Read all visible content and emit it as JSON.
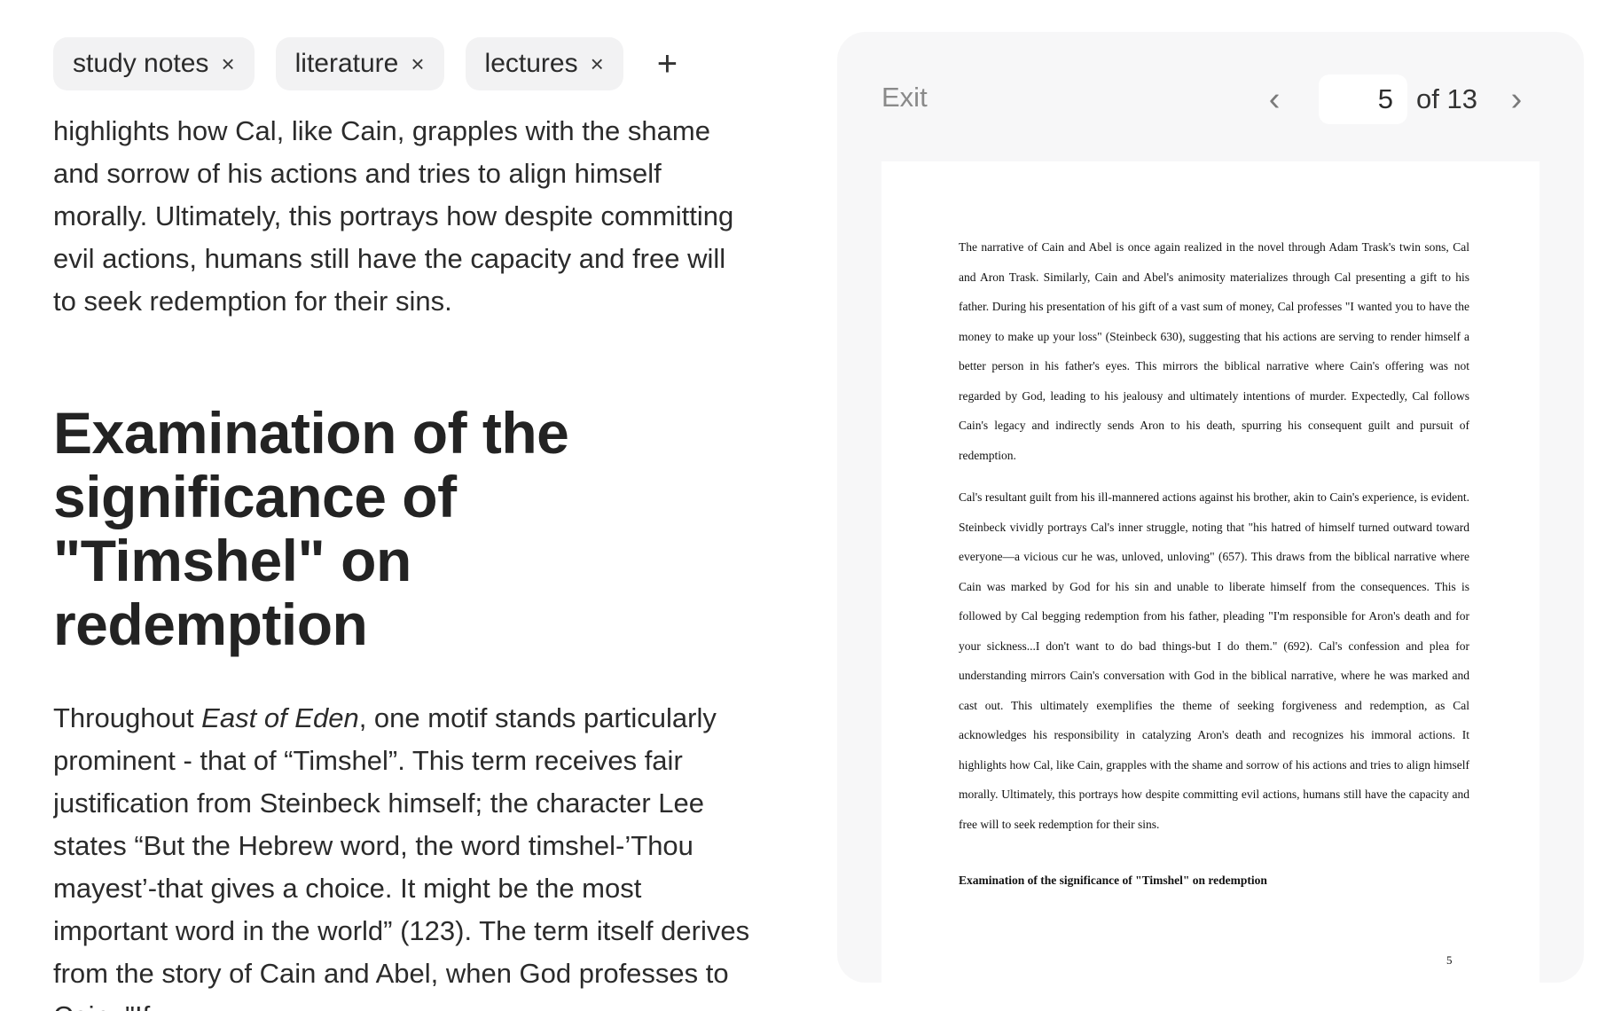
{
  "tags": [
    {
      "label": "study notes",
      "remove": "×"
    },
    {
      "label": "literature",
      "remove": "×"
    },
    {
      "label": "lectures",
      "remove": "×"
    }
  ],
  "add_tag": "+",
  "editor": {
    "paragraph_top": "highlights how Cal, like Cain, grapples with the shame and sorrow of his actions and tries to align himself morally. Ultimately, this portrays how despite committing evil actions, humans still have the capacity and free will to seek redemption for their sins.",
    "heading": "Examination of the significance of \"Timshel\" on redemption",
    "paragraph_bottom_pre": "Throughout ",
    "paragraph_bottom_italic": "East of Eden",
    "paragraph_bottom_post": ", one motif stands particularly prominent - that of “Timshel”. This term receives fair justification from Steinbeck himself; the character Lee states “But the Hebrew word, the word timshel-’Thou mayest’-that gives a choice. It might be the most important word in the world” (123). The term itself derives from the story of Cain and Abel, when God professes to Cain: \"If"
  },
  "viewer": {
    "exit_label": "Exit",
    "prev_icon": "‹",
    "next_icon": "›",
    "current_page": "5",
    "of_total": "of 13",
    "document": {
      "paragraph1": "The narrative of Cain and Abel is once again realized in the novel through Adam Trask's twin sons, Cal and Aron Trask. Similarly, Cain and Abel's animosity materializes through Cal presenting a gift to his father. During his presentation of his gift of a vast sum of money, Cal professes \"I wanted you to have the money to make up your loss\" (Steinbeck 630), suggesting that his actions are serving to render himself a better person in his father's eyes. This mirrors the biblical narrative where Cain's offering was not regarded by God, leading to his jealousy and ultimately intentions of murder. Expectedly, Cal follows Cain's legacy and indirectly sends Aron to his death, spurring his consequent guilt and pursuit of redemption.",
      "paragraph2": "Cal's resultant guilt from his ill-mannered actions against his brother, akin to Cain's experience, is evident. Steinbeck vividly portrays Cal's inner struggle, noting that \"his hatred of himself turned outward toward everyone—a vicious cur he was, unloved, unloving\" (657). This draws from the biblical narrative where Cain was marked by God for his sin and unable to liberate himself from the consequences. This is followed by Cal begging redemption from his father, pleading \"I'm responsible for Aron's death and for your sickness...I don't want to do bad things-but I do them.\" (692). Cal's confession and plea for understanding mirrors Cain's conversation with God in the biblical narrative, where he was marked and cast out. This ultimately exemplifies the theme of seeking forgiveness and redemption, as Cal acknowledges his responsibility in catalyzing Aron's death and recognizes his immoral actions. It highlights how Cal, like Cain, grapples with the shame and sorrow of his actions and tries to align himself morally. Ultimately, this portrays how despite committing evil actions, humans still have the capacity and free will to seek redemption for their sins.",
      "heading": "Examination of the significance of \"Timshel\" on redemption",
      "page_number": "5"
    }
  }
}
